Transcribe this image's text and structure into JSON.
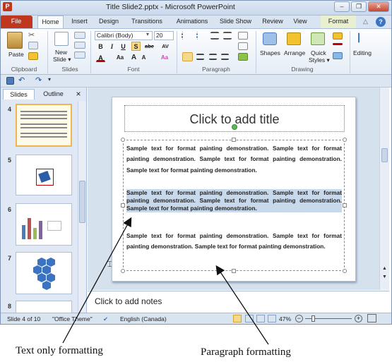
{
  "window": {
    "title": "Title Slide2.pptx - Microsoft PowerPoint",
    "app_icon": "P"
  },
  "tabs": [
    "File",
    "Home",
    "Insert",
    "Design",
    "Transitions",
    "Animations",
    "Slide Show",
    "Review",
    "View",
    "Format"
  ],
  "ribbon": {
    "clipboard": {
      "paste": "Paste",
      "group": "Clipboard"
    },
    "slides": {
      "new_slide": "New",
      "new_slide2": "Slide ▾",
      "group": "Slides"
    },
    "font": {
      "name": "Calibri (Body)",
      "size": "20",
      "bold": "B",
      "italic": "I",
      "underline": "U",
      "shadow": "S",
      "strike": "abe",
      "spacing": "AV",
      "case": "Aa",
      "group": "Font",
      "grow": "A",
      "shrink": "A",
      "color": "A",
      "clear": "Aa"
    },
    "paragraph": {
      "group": "Paragraph"
    },
    "drawing": {
      "shapes": "Shapes",
      "arrange": "Arrange",
      "quick": "Quick",
      "styles": "Styles ▾",
      "group": "Drawing"
    },
    "editing": {
      "label": "Editing"
    }
  },
  "panel": {
    "tabs": [
      "Slides",
      "Outline"
    ],
    "close": "×",
    "slide_numbers": [
      "4",
      "5",
      "6",
      "7",
      "8"
    ]
  },
  "slide": {
    "title_placeholder": "Click to add title",
    "para1": "Sample text for format painting demonstration. Sample text for format painting demonstration. Sample text for format painting demonstration. Sample text for format painting demonstration.",
    "para2": "Sample text for format painting demonstration. Sample text for format painting demonstration. Sample text for format painting demonstration. Sample text for format painting demonstration.",
    "para3": "Sample text for format painting demonstration. Sample text for format painting demonstration. Sample text for format painting demonstration."
  },
  "notes": "Click to add notes",
  "status": {
    "slide": "Slide 4 of 10",
    "theme": "\"Office Theme\"",
    "language": "English (Canada)",
    "zoom": "47%"
  },
  "captions": {
    "left": "Text only formatting",
    "right": "Paragraph formatting"
  }
}
